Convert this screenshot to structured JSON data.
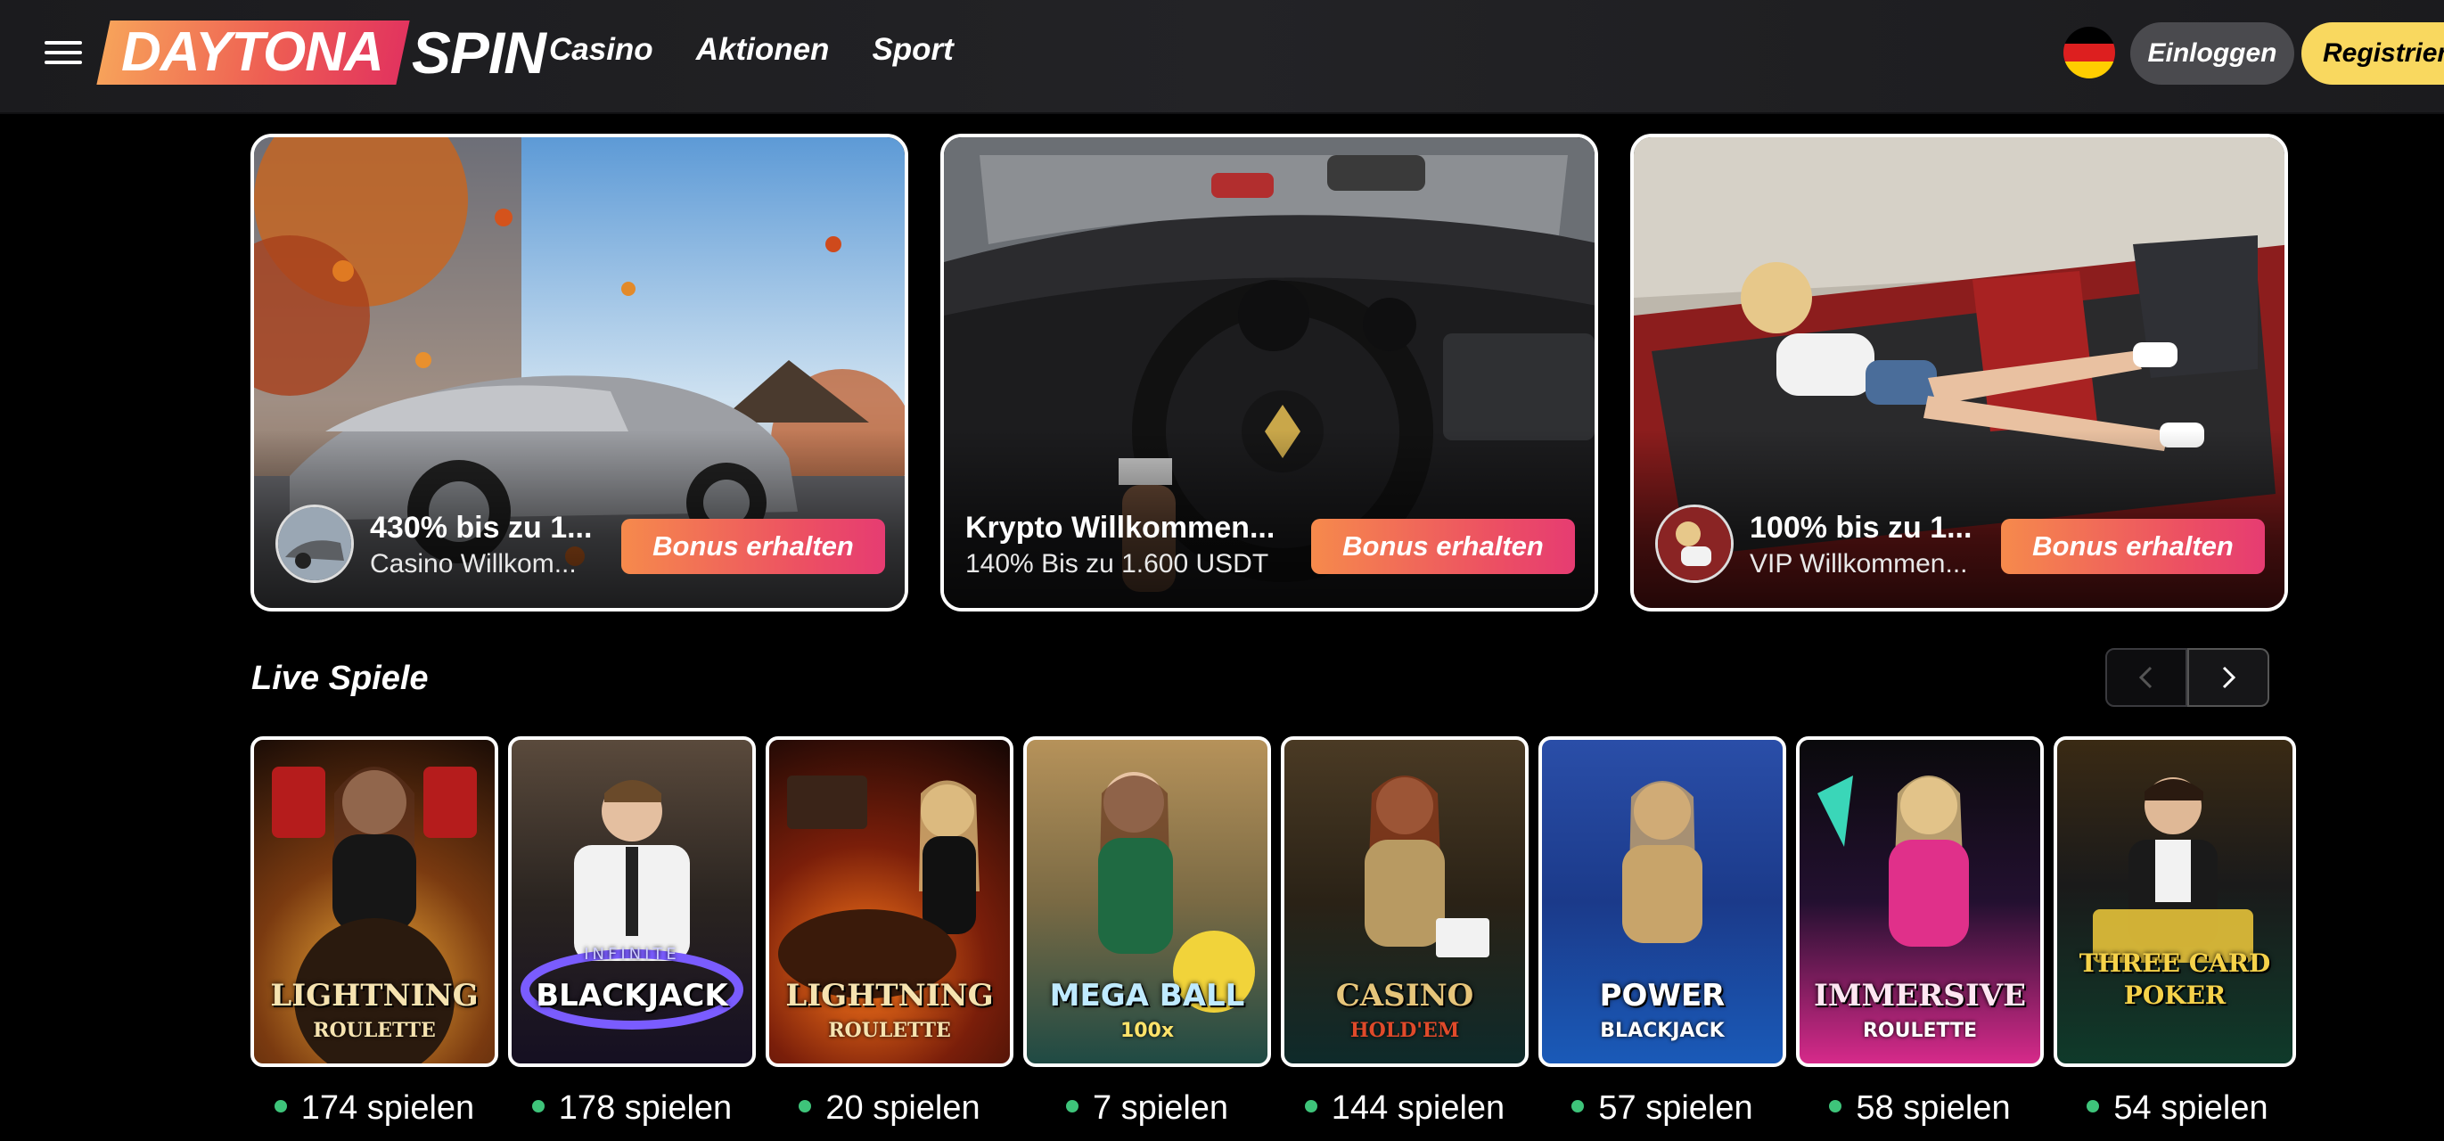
{
  "header": {
    "logo_part1": "DAYTONA",
    "logo_part2": "SPIN",
    "nav": [
      "Casino",
      "Aktionen",
      "Sport"
    ],
    "login_label": "Einloggen",
    "register_label": "Registriere"
  },
  "promos": [
    {
      "title": "430% bis zu 1...",
      "subtitle": "Casino Willkom...",
      "button": "Bonus erhalten"
    },
    {
      "title": "Krypto Willkommen...",
      "subtitle": "140% Bis zu 1.600 USDT",
      "button": "Bonus erhalten"
    },
    {
      "title": "100% bis zu 1...",
      "subtitle": "VIP Willkommen...",
      "button": "Bonus erhalten"
    }
  ],
  "live": {
    "title": "Live Spiele",
    "games": [
      {
        "name": "LIGHTNING",
        "sub": "ROULETTE",
        "count": "174 spielen"
      },
      {
        "name": "BLACKJACK",
        "sub": "INFINITE",
        "count": "178 spielen"
      },
      {
        "name": "LIGHTNING",
        "sub": "ROULETTE",
        "count": "20 spielen"
      },
      {
        "name": "MEGA BALL",
        "sub": "100x",
        "count": "7 spielen"
      },
      {
        "name": "CASINO",
        "sub": "HOLD'EM",
        "count": "144 spielen"
      },
      {
        "name": "POWER",
        "sub": "BLACKJACK",
        "count": "57 spielen"
      },
      {
        "name": "IMMERSIVE",
        "sub": "ROULETTE",
        "count": "58 spielen"
      },
      {
        "name": "THREE CARD POKER",
        "sub": "",
        "count": "54 spielen"
      }
    ]
  },
  "colors": {
    "accent_yellow": "#f9d85f",
    "bonus_gradient_start": "#f68a4c",
    "bonus_gradient_end": "#e63c72",
    "online_dot": "#3ec47a"
  },
  "icons": {
    "menu": "hamburger-icon",
    "flag": "germany-flag-icon",
    "prev": "chevron-left-icon",
    "next": "chevron-right-icon"
  }
}
